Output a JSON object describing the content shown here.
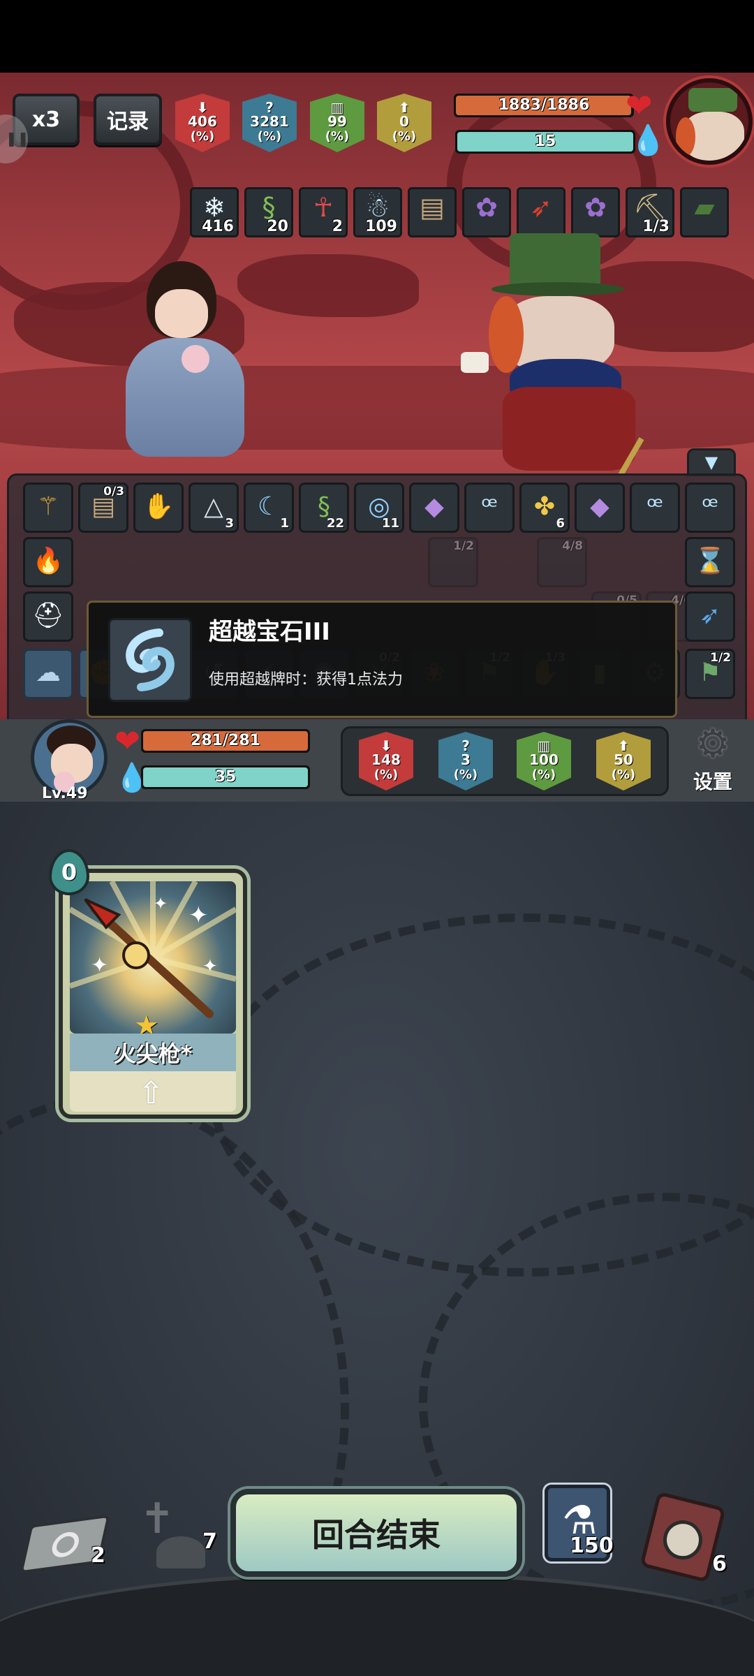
{
  "top": {
    "speed_label": "x3",
    "log_label": "记录"
  },
  "enemy_stats": [
    {
      "value": "406",
      "unit": "(%)",
      "color": "#c33b3b",
      "icon": "attack-arrow-icon"
    },
    {
      "value": "3281",
      "unit": "(%)",
      "color": "#3d7a93",
      "icon": "question-icon"
    },
    {
      "value": "99",
      "unit": "(%)",
      "color": "#5e9a3f",
      "icon": "pillars-icon"
    },
    {
      "value": "0",
      "unit": "(%)",
      "color": "#b29d3c",
      "icon": "up-arrow-icon"
    }
  ],
  "enemy": {
    "hp_text": "1883/1886",
    "hp_fraction": 0.998,
    "mana_text": "15"
  },
  "enemy_buffs": [
    {
      "icon": "snowflake-icon",
      "count": "416"
    },
    {
      "icon": "green-serpent-icon",
      "count": "20"
    },
    {
      "icon": "red-dancer-icon",
      "count": "2"
    },
    {
      "icon": "ghost-icon",
      "count": "109"
    },
    {
      "icon": "book-icon",
      "count": ""
    },
    {
      "icon": "flower-bush-icon",
      "count": ""
    },
    {
      "icon": "red-pepper-icon",
      "count": ""
    },
    {
      "icon": "flower-bush-icon",
      "count": ""
    },
    {
      "icon": "pickaxe-icon",
      "count": "1/3"
    },
    {
      "icon": "green-hat-icon",
      "count": ""
    }
  ],
  "relics_row1": [
    {
      "icon": "scepter-icon",
      "badge": "",
      "count": ""
    },
    {
      "icon": "book-icon",
      "badge": "0/3",
      "count": ""
    },
    {
      "icon": "glove-icon",
      "badge": "",
      "count": ""
    },
    {
      "icon": "triangle-rune-icon",
      "badge": "",
      "count": "3"
    },
    {
      "icon": "moon-rune-icon",
      "badge": "",
      "count": "1"
    },
    {
      "icon": "green-serpent-icon",
      "badge": "",
      "count": "22"
    },
    {
      "icon": "blue-mask-icon",
      "badge": "",
      "count": "11"
    },
    {
      "icon": "purple-gem-icon",
      "badge": "",
      "count": ""
    },
    {
      "icon": "wind-gem-icon",
      "badge": "",
      "count": ""
    },
    {
      "icon": "gold-clover-icon",
      "badge": "",
      "count": "6"
    },
    {
      "icon": "purple-gem-icon",
      "badge": "",
      "count": ""
    },
    {
      "icon": "wind-gem-icon",
      "badge": "",
      "count": ""
    },
    {
      "icon": "wind-gem-icon",
      "badge": "",
      "count": ""
    }
  ],
  "relics_row2_right": [
    {
      "icon": "hourglass-icon",
      "badge": ""
    }
  ],
  "relics_row3_right": [
    {
      "icon": "blue-feather-icon",
      "badge": ""
    }
  ],
  "skills_row": [
    {
      "icon": "cloud-skill-icon",
      "badge": ""
    },
    {
      "icon": "hand-skill-icon",
      "badge": ""
    },
    {
      "icon": "clover-skill-icon",
      "badge": ""
    },
    {
      "icon": "swirl-skill-icon",
      "badge": ""
    },
    {
      "icon": "runner-skill-icon",
      "badge": ""
    },
    {
      "icon": "burst-skill-icon",
      "badge": ""
    },
    {
      "icon": "warrior-icon",
      "badge": "0/2"
    },
    {
      "icon": "flower-icon",
      "badge": ""
    },
    {
      "icon": "banner-icon",
      "badge": "1/2"
    },
    {
      "icon": "hand-icon",
      "badge": "1/3"
    },
    {
      "icon": "green-tube-icon",
      "badge": ""
    },
    {
      "icon": "robot-icon",
      "badge": ""
    },
    {
      "icon": "banner-icon",
      "badge": "1/2"
    }
  ],
  "tooltip": {
    "icon": "wind-gem-icon",
    "title": "超越宝石III",
    "description": "使用超越牌时：获得1点法力"
  },
  "player": {
    "level": "Lv.49",
    "hp_text": "281/281",
    "hp_fraction": 1.0,
    "mana_text": "35"
  },
  "player_stats": [
    {
      "value": "148",
      "unit": "(%)",
      "color": "#c33b3b",
      "icon": "attack-arrow-icon"
    },
    {
      "value": "3",
      "unit": "(%)",
      "color": "#3d7a93",
      "icon": "question-icon"
    },
    {
      "value": "100",
      "unit": "(%)",
      "color": "#5e9a3f",
      "icon": "pillars-icon"
    },
    {
      "value": "50",
      "unit": "(%)",
      "color": "#b29d3c",
      "icon": "up-arrow-icon"
    }
  ],
  "settings_label": "设置",
  "hand": [
    {
      "name": "火尖枪*",
      "cost": "0",
      "icon": "fire-spear-icon"
    }
  ],
  "bottom": {
    "draw_pile_count": "2",
    "discard_pile_count": "7",
    "end_turn_label": "回合结束",
    "potion_count": "150",
    "exhaust_pile_count": "6"
  },
  "colors": {
    "hp_bar": "#d66a3a",
    "mana_bar": "#7fd3c8",
    "heart": "#d8282d"
  }
}
